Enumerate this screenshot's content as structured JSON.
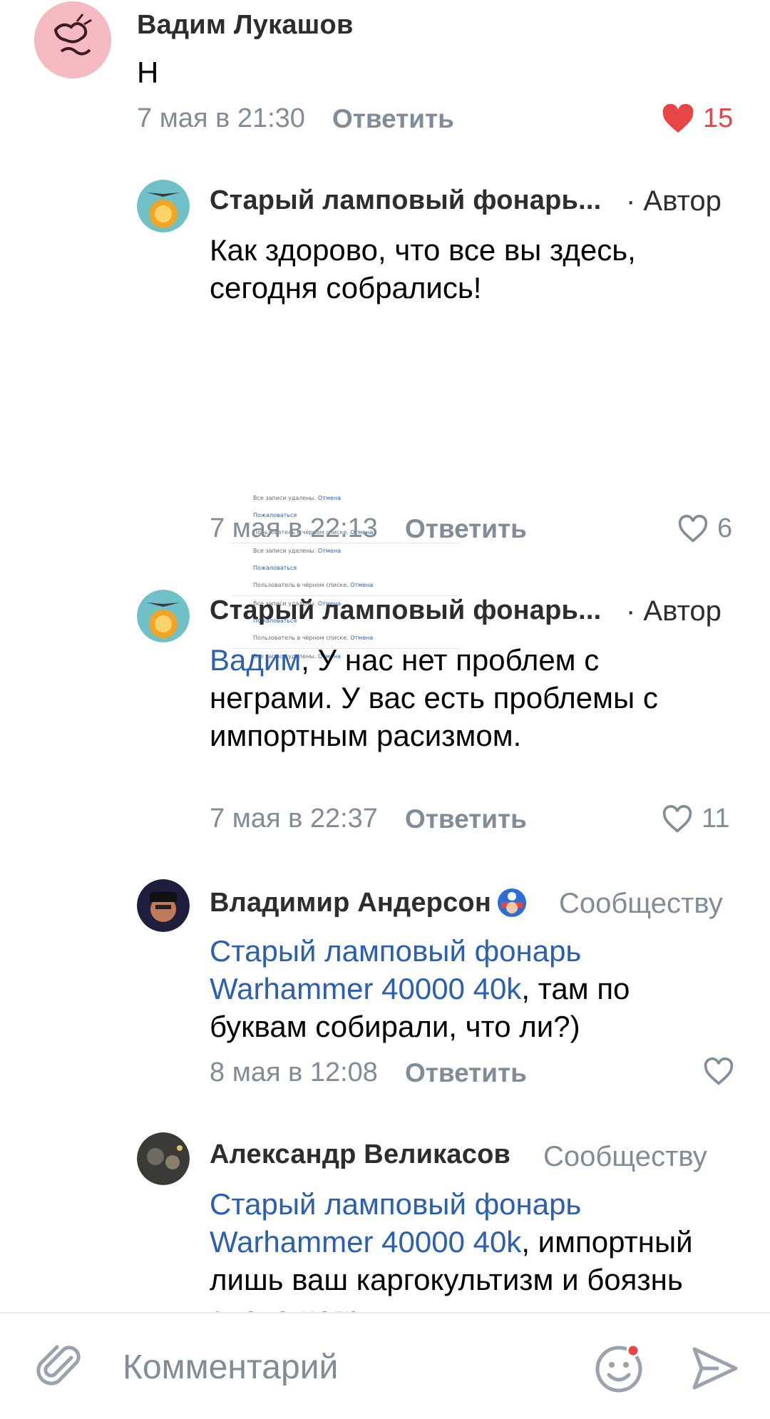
{
  "comments": [
    {
      "author": "Вадим Лукашов",
      "tag": "",
      "text": "Н",
      "date": "7 мая в 21:30",
      "reply": "Ответить",
      "likes": "15",
      "liked": true
    },
    {
      "author": "Старый ламповый фонарь...",
      "tag": "· Автор",
      "text": "Как здорово, что все вы здесь, сегодня собрались!",
      "attachment": {
        "lines": [
          {
            "text": "Все записи удалены.",
            "link": "Отмена"
          },
          {
            "text": "",
            "link": "Пожаловаться"
          },
          {
            "text": "Пользователь в чёрном списке.",
            "link": "Отмена"
          },
          {
            "text": "Все записи удалены.",
            "link": "Отмена"
          },
          {
            "text": "",
            "link": "Пожаловаться"
          },
          {
            "text": "Пользователь в чёрном списке.",
            "link": "Отмена"
          },
          {
            "text": "Все записи удалены.",
            "link": "Отмена"
          },
          {
            "text": "",
            "link": "Пожаловаться"
          },
          {
            "text": "Пользователь в чёрном списке.",
            "link": "Отмена"
          },
          {
            "text": "Все записи удалены.",
            "link": "Отмена"
          }
        ]
      },
      "date": "7 мая в 22:13",
      "reply": "Ответить",
      "likes": "6",
      "liked": false
    },
    {
      "author": "Старый ламповый фонарь...",
      "tag": "· Автор",
      "mention": "Вадим",
      "text_line1": ", У нас нет проблем с",
      "text_rest": "неграми. У вас есть проблемы с импортным расизмом.",
      "date": "7 мая в 22:37",
      "reply": "Ответить",
      "likes": "11",
      "liked": false
    },
    {
      "author": "Владимир Андерсон",
      "tag": "Сообществу",
      "mention": "Старый ламповый фонарь Warhammer 40000 40k",
      "text": ", там по буквам собирали, что ли?)",
      "date": "8 мая в 12:08",
      "reply": "Ответить",
      "likes": "",
      "liked": false
    },
    {
      "author": "Александр Великасов",
      "tag": "Сообществу",
      "mention": "Старый ламповый фонарь Warhammer 40000 40k",
      "text": ", импортный лишь ваш каргокультизм и боязнь слова негр",
      "date": "",
      "reply": "",
      "likes": "",
      "liked": false
    }
  ],
  "composer": {
    "placeholder": "Комментарий"
  },
  "colors": {
    "accent": "#2a5fb3",
    "like_active": "#e64646",
    "secondary_text": "#818c99"
  }
}
